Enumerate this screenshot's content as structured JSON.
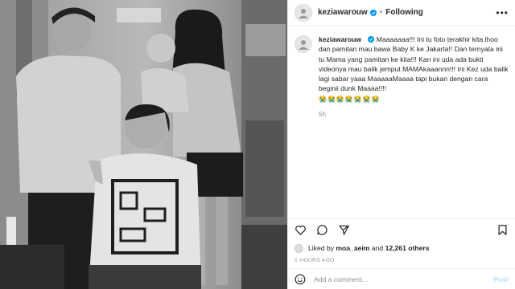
{
  "post": {
    "username": "keziawarouw",
    "follow_label": "Following",
    "caption": "Maaaaaaa!!! Ini tu foto terakhir kita lhoo dan pamitan mau bawa Baby K ke Jakarta!! Dan ternyata ini tu Mama yang pamitan ke kita!!! Kan ini uda ada bukti videonya mau balik jemput MAMAkaaannn!!! Ini Kez uda balik lagi sabar yaaa MaaaaaMaaaa tapi bukan dengan cara beginii dunk Maaaa!!!!",
    "caption_emojis": "😭😭😭😭😭😭😭",
    "comment_time": "5h",
    "liked_by_user": "moa_aeim",
    "likes_count": "12,261 others",
    "time_ago": "5 HOURS AGO",
    "add_comment_placeholder": "Add a comment...",
    "post_label": "Post"
  },
  "icons": [
    "heart-icon",
    "comment-icon",
    "share-icon",
    "bookmark-icon",
    "smile-icon",
    "more-icon",
    "verified-icon"
  ],
  "colors": {
    "verified": "#0095f6",
    "muted": "#8e8e8e",
    "post_disabled": "#b2dffc"
  }
}
